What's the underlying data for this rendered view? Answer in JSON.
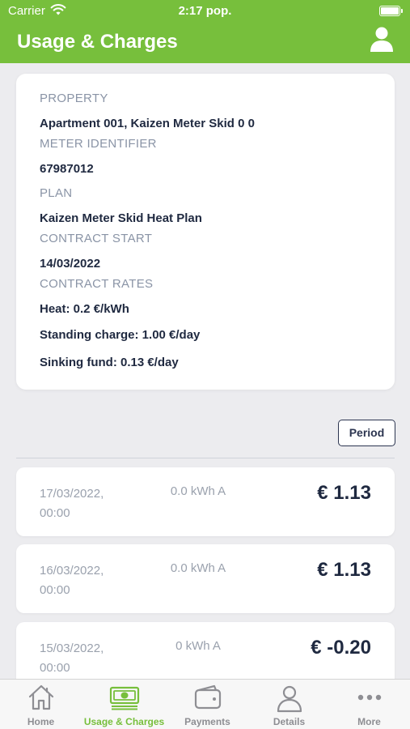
{
  "status_bar": {
    "carrier": "Carrier",
    "time": "2:17 pop."
  },
  "header": {
    "title": "Usage & Charges"
  },
  "info": {
    "property_label": "PROPERTY",
    "property_value": "Apartment 001, Kaizen Meter Skid 0 0",
    "meter_label": "METER IDENTIFIER",
    "meter_value": "67987012",
    "plan_label": "PLAN",
    "plan_value": "Kaizen Meter Skid Heat Plan",
    "contract_start_label": "CONTRACT START",
    "contract_start_value": "14/03/2022",
    "contract_rates_label": "CONTRACT RATES",
    "rates": [
      "Heat: 0.2 €/kWh",
      "Standing charge: 1.00 €/day",
      "Sinking fund: 0.13 €/day"
    ]
  },
  "period_button": "Period",
  "entries": [
    {
      "date": "17/03/2022,",
      "time": "00:00",
      "usage": "0.0 kWh A",
      "amount": "€ 1.13"
    },
    {
      "date": "16/03/2022,",
      "time": "00:00",
      "usage": "0.0 kWh A",
      "amount": "€ 1.13"
    },
    {
      "date": "15/03/2022,",
      "time": "00:00",
      "usage": "0 kWh A",
      "amount": "€ -0.20"
    }
  ],
  "tabs": [
    {
      "label": "Home",
      "icon": "home-icon",
      "active": false
    },
    {
      "label": "Usage & Charges",
      "icon": "money-icon",
      "active": true
    },
    {
      "label": "Payments",
      "icon": "wallet-icon",
      "active": false
    },
    {
      "label": "Details",
      "icon": "person-icon",
      "active": false
    },
    {
      "label": "More",
      "icon": "more-icon",
      "active": false
    }
  ],
  "colors": {
    "brand_green": "#77bf3c",
    "text_dark": "#1f2940",
    "label_gray": "#8a94a6",
    "inactive_tab": "#8e8e93"
  }
}
